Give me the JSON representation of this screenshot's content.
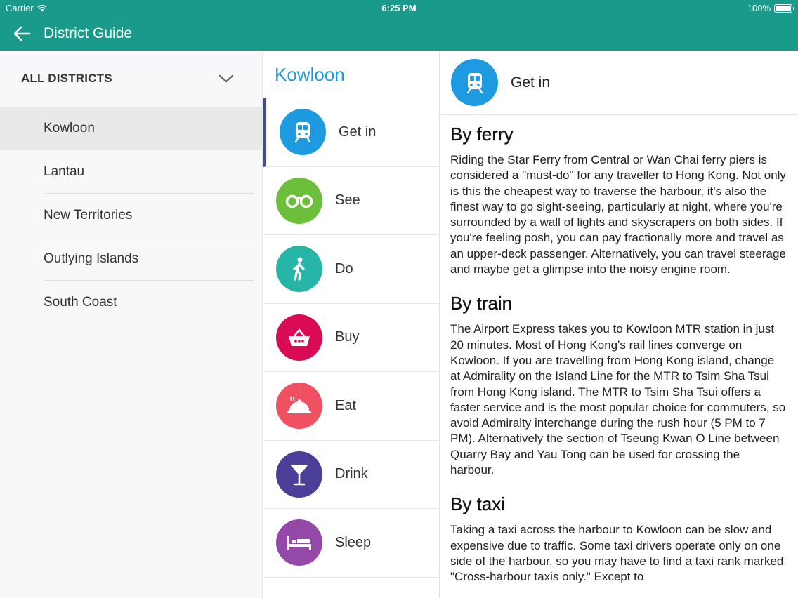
{
  "status_bar": {
    "carrier": "Carrier",
    "time": "6:25 PM",
    "battery": "100%"
  },
  "app_bar": {
    "title": "District Guide",
    "back_icon": "arrow-left-icon"
  },
  "sidebar": {
    "header_label": "ALL DISTRICTS",
    "districts": [
      {
        "label": "Kowloon",
        "selected": true
      },
      {
        "label": "Lantau",
        "selected": false
      },
      {
        "label": "New Territories",
        "selected": false
      },
      {
        "label": "Outlying Islands",
        "selected": false
      },
      {
        "label": "South Coast",
        "selected": false
      }
    ]
  },
  "middle": {
    "title": "Kowloon",
    "categories": [
      {
        "label": "Get in",
        "icon": "train-icon",
        "color": "#1e9be0",
        "active": true
      },
      {
        "label": "See",
        "icon": "binoculars-icon",
        "color": "#6cbf3a",
        "active": false
      },
      {
        "label": "Do",
        "icon": "walking-person-icon",
        "color": "#26b5a6",
        "active": false
      },
      {
        "label": "Buy",
        "icon": "basket-icon",
        "color": "#d90b55",
        "active": false
      },
      {
        "label": "Eat",
        "icon": "food-cloche-icon",
        "color": "#ef5162",
        "active": false
      },
      {
        "label": "Drink",
        "icon": "cocktail-glass-icon",
        "color": "#4c3f99",
        "active": false
      },
      {
        "label": "Sleep",
        "icon": "bed-icon",
        "color": "#9448a8",
        "active": false
      }
    ]
  },
  "content": {
    "header_title": "Get in",
    "header_icon": "train-icon",
    "sections": [
      {
        "heading": "By ferry",
        "text": "Riding the Star Ferry from Central or Wan Chai ferry piers is considered a \"must-do\" for any traveller to Hong Kong. Not only is this the cheapest way to traverse the harbour, it's also the finest way to go sight-seeing, particularly at night, where you're surrounded by a wall of lights and skyscrapers on both sides. If you're feeling posh, you can pay fractionally more and travel as an upper-deck passenger. Alternatively, you can travel steerage and maybe get a glimpse into the noisy engine room."
      },
      {
        "heading": "By train",
        "text": "The Airport Express takes you to Kowloon MTR station in just 20 minutes. Most of Hong Kong's rail lines converge on Kowloon. If you are travelling from Hong Kong island, change at Admirality on the Island Line for the MTR to Tsim Sha Tsui from Hong Kong island. The MTR to Tsim Sha Tsui offers a faster service and is the most popular choice for commuters, so avoid Admiralty interchange during the rush hour (5 PM to 7 PM). Alternatively the section of Tseung Kwan O Line between Quarry Bay and Yau Tong can be used for crossing the harbour."
      },
      {
        "heading": "By taxi",
        "text": "Taking a taxi across the harbour to Kowloon can be slow and expensive due to traffic. Some taxi drivers operate only on one side of the harbour, so you may have to find a taxi rank marked \"Cross-harbour taxis only.\" Except to"
      }
    ]
  }
}
